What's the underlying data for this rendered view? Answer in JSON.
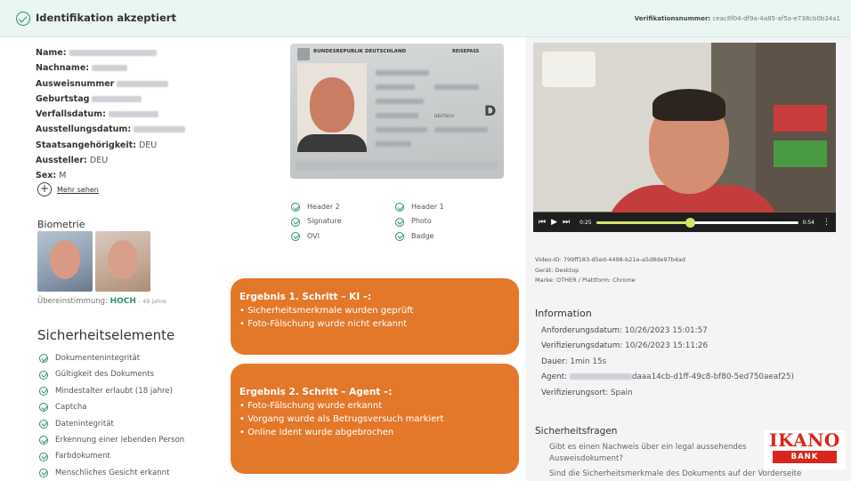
{
  "header": {
    "title": "Identifikation akzeptiert",
    "verification_label": "Verifikationsnummer:",
    "verification_number": "ceac8f04-df9a-4a85-af5a-e738cb0b34a1"
  },
  "fields": [
    {
      "label": "Name:",
      "value": ""
    },
    {
      "label": "Nachname:",
      "value": ""
    },
    {
      "label": "Ausweisnummer",
      "value": ""
    },
    {
      "label": "Geburtstag",
      "value": ""
    },
    {
      "label": "Verfallsdatum:",
      "value": ""
    },
    {
      "label": "Ausstellungsdatum:",
      "value": ""
    },
    {
      "label": "Staatsangehörigkeit:",
      "value": "DEU"
    },
    {
      "label": "Aussteller:",
      "value": "DEU"
    },
    {
      "label": "Sex:",
      "value": "M"
    }
  ],
  "more_link": "Mehr sehen",
  "biometrics": {
    "title": "Biometrie",
    "match_label": "Übereinstimmung:",
    "match_value": "HOCH",
    "match_years": "- 49 jahre"
  },
  "passport": {
    "country_title": "BUNDESREPUBLIK DEUTSCHLAND",
    "doc_type": "REISEPASS",
    "letter": "D",
    "nationality": "DEUTSCH"
  },
  "doc_checks": [
    {
      "label": "Header 2"
    },
    {
      "label": "Header 1"
    },
    {
      "label": "Signature"
    },
    {
      "label": "Photo"
    },
    {
      "label": "OVI"
    },
    {
      "label": "Badge"
    }
  ],
  "security": {
    "title": "Sicherheitselemente",
    "items": [
      "Dokumentenintegrität",
      "Gültigkeit des Dokuments",
      "Mindestalter erlaubt (18 jahre)",
      "Captcha",
      "Datenintegrität",
      "Erkennung einer lebenden Person",
      "Farbdokument",
      "Menschliches Gesicht erkannt"
    ]
  },
  "overlay1": {
    "title": "Ergebnis 1. Schritt – KI –:",
    "lines": [
      "• Sicherheitsmerkmale wurden geprüft",
      "• Foto-Fälschung wurde nicht erkannt"
    ]
  },
  "overlay2": {
    "title": "Ergebnis 2. Schritt – Agent –:",
    "lines": [
      "• Foto-Fälschung wurde erkannt",
      "• Vorgang wurde als Betrugsversuch markiert",
      "• Online Ident wurde abgebrochen"
    ]
  },
  "video": {
    "current_time": "0:25",
    "duration": "0:54",
    "progress": 0.463,
    "id_line": "Video-ID: 799ff183-d5ed-4498-b21e-a5d8de97b4ad",
    "device_line": "Gerät: Desktop",
    "brand_line": "Marke: OTHER  /  Plattform: Chrome"
  },
  "information": {
    "title": "Information",
    "rows": [
      {
        "label": "Anforderungsdatum:",
        "value": "10/26/2023 15:01:57"
      },
      {
        "label": "Verifizierungsdatum:",
        "value": "10/26/2023 15:11:26"
      },
      {
        "label": "Dauer:",
        "value": "1min 15s"
      },
      {
        "label": "Agent:",
        "value": "daaa14cb-d1ff-49c8-bf80-5ed750aeaf25)"
      },
      {
        "label": "Verifizierungsort:",
        "value": "Spain"
      }
    ]
  },
  "security_questions": {
    "title": "Sicherheitsfragen",
    "q1": "Gibt es einen Nachweis über ein legal aussehendes Ausweisdokument?",
    "q2": "Sind die Sicherheitsmerkmale des Dokuments auf der Vorderseite"
  },
  "logo": {
    "word": "IKANO",
    "sub": "BANK",
    "color": "#d9261c"
  },
  "colors": {
    "accent_green": "#2f8f6f",
    "overlay_orange": "#e3782a",
    "progress_yellow": "#d6e36a"
  }
}
